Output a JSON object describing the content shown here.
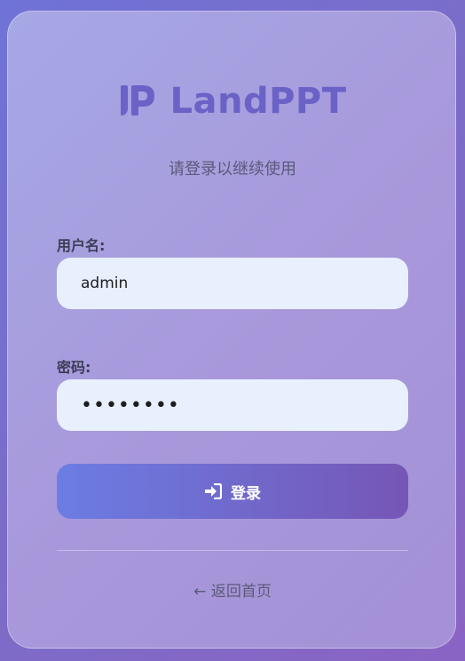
{
  "brand": {
    "name": "LandPPT",
    "logo_icon": "landppt-logo-icon"
  },
  "subtitle": "请登录以继续使用",
  "form": {
    "username_label": "用户名:",
    "username_value": "admin",
    "password_label": "密码:",
    "password_mask": "••••••••"
  },
  "login_button": {
    "label": "登录",
    "icon": "sign-in-icon"
  },
  "back_link": "← 返回首页",
  "colors": {
    "brand": "#6a62c6",
    "button_start": "#6b7de3",
    "button_end": "#7656b6",
    "input_bg": "#e8f0fd"
  }
}
